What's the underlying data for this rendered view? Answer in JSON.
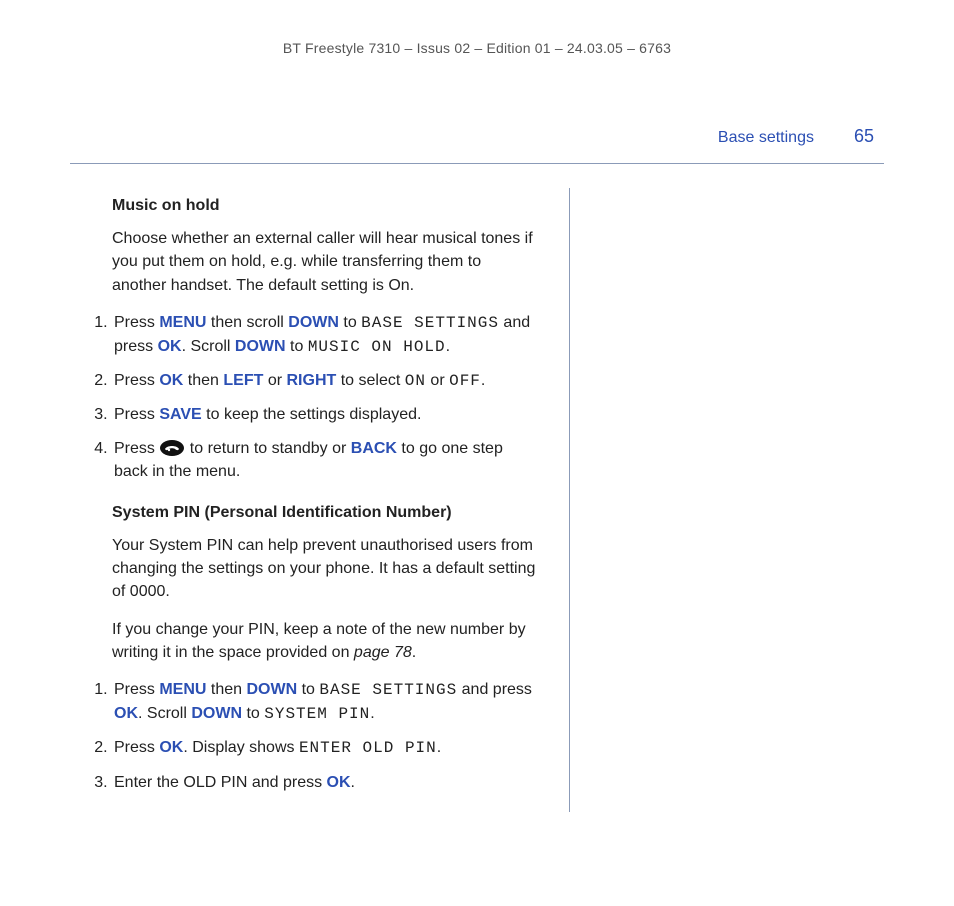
{
  "meta": {
    "top": "BT Freestyle 7310 – Issus 02 – Edition 01 – 24.03.05 – 6763"
  },
  "header": {
    "section": "Base settings",
    "page": "65"
  },
  "s1": {
    "title": "Music on hold",
    "intro": "Choose whether an external caller will hear musical tones if you put them on hold, e.g. while transferring them to another handset. The default setting is On.",
    "li1": {
      "a": "Press ",
      "menu": "MENU",
      "b": " then scroll ",
      "down1": "DOWN",
      "c": " to ",
      "lcd1": "BASE SETTINGS",
      "d": " and press ",
      "ok1": "OK",
      "e": ". Scroll ",
      "down2": "DOWN",
      "f": " to ",
      "lcd2": "MUSIC ON HOLD",
      "g": "."
    },
    "li2": {
      "a": "Press ",
      "ok": "OK",
      "b": " then ",
      "left": "LEFT",
      "c": " or ",
      "right": "RIGHT",
      "d": " to select ",
      "on": "ON",
      "e": " or ",
      "off": "OFF",
      "f": "."
    },
    "li3": {
      "a": "Press ",
      "save": "SAVE",
      "b": " to keep the settings displayed."
    },
    "li4": {
      "a": "Press ",
      "b": " to return to standby or ",
      "back": "BACK",
      "c": " to go one step back in the menu."
    }
  },
  "s2": {
    "title": "System PIN (Personal Identification Number)",
    "p1": "Your System PIN can help prevent unauthorised users from changing the settings on your phone. It has a default setting of 0000.",
    "p2a": "If you change your PIN, keep a note of the new number by writing it in the space provided on ",
    "p2ref": "page 78",
    "p2b": ".",
    "li1": {
      "a": "Press ",
      "menu": "MENU",
      "b": " then ",
      "down1": "DOWN",
      "c": " to ",
      "lcd1": "BASE SETTINGS",
      "d": " and press ",
      "ok1": "OK",
      "e": ". Scroll ",
      "down2": "DOWN",
      "f": " to ",
      "lcd2": "SYSTEM PIN",
      "g": "."
    },
    "li2": {
      "a": "Press ",
      "ok": "OK",
      "b": ". Display shows ",
      "lcd": "ENTER OLD PIN",
      "c": "."
    },
    "li3": {
      "a": "Enter the OLD PIN and press ",
      "ok": "OK",
      "b": "."
    }
  }
}
